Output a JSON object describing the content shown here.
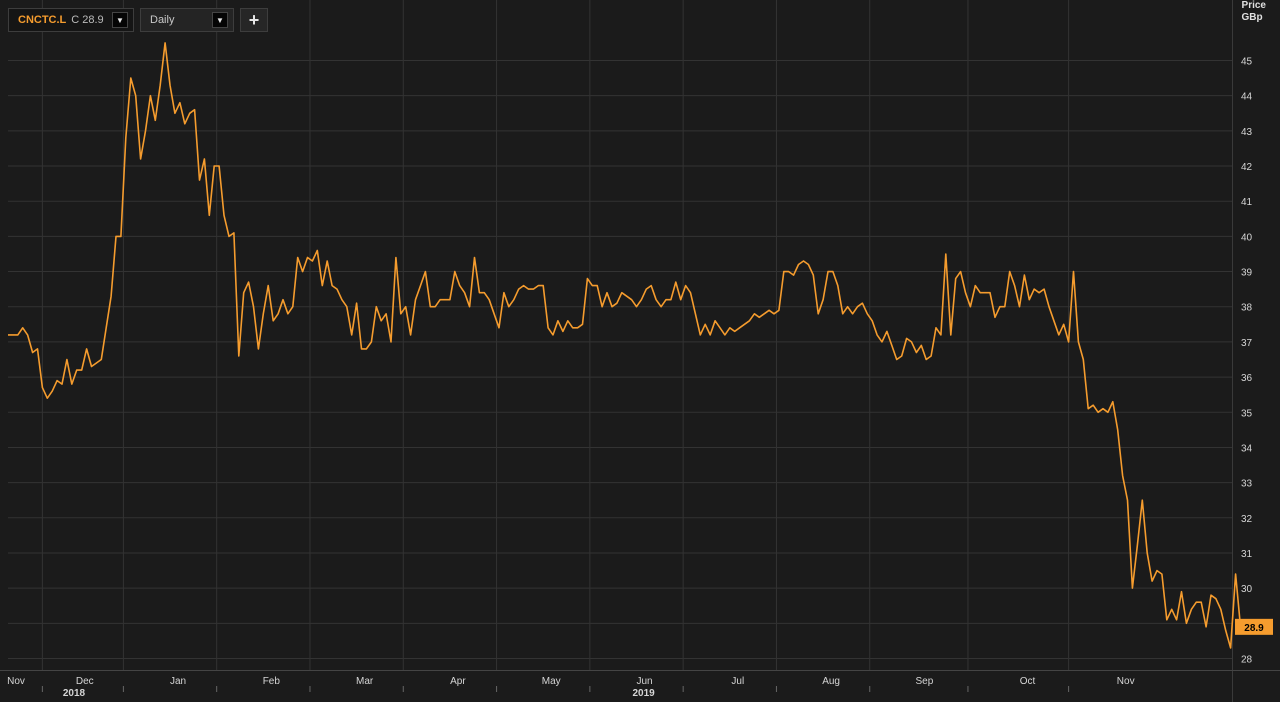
{
  "toolbar": {
    "symbol": "CNCTC.L",
    "close_label": "C",
    "close_value": "28.9",
    "interval": "Daily",
    "add_label": "+"
  },
  "axis": {
    "unit_line1": "Price",
    "unit_line2": "GBp"
  },
  "colors": {
    "line": "#f59c2e",
    "background": "#1b1b1b",
    "grid": "#333333"
  },
  "chart_data": {
    "type": "line",
    "title": "",
    "xlabel": "",
    "ylabel": "Price GBp",
    "ylim": [
      27.6,
      45.9
    ],
    "y_ticks": [
      28,
      29,
      30,
      31,
      32,
      33,
      34,
      35,
      36,
      37,
      38,
      39,
      40,
      41,
      42,
      43,
      44,
      45
    ],
    "x_range": [
      0,
      245
    ],
    "x_ticks": [
      {
        "x": 0,
        "label": "Nov"
      },
      {
        "x": 14,
        "label": "Dec"
      },
      {
        "x": 33,
        "label": "Jan"
      },
      {
        "x": 52,
        "label": "Feb"
      },
      {
        "x": 71,
        "label": "Mar"
      },
      {
        "x": 90,
        "label": "Apr"
      },
      {
        "x": 109,
        "label": "May"
      },
      {
        "x": 128,
        "label": "Jun"
      },
      {
        "x": 147,
        "label": "Jul"
      },
      {
        "x": 166,
        "label": "Aug"
      },
      {
        "x": 185,
        "label": "Sep"
      },
      {
        "x": 206,
        "label": "Oct"
      },
      {
        "x": 226,
        "label": "Nov"
      }
    ],
    "year_labels": [
      {
        "x": 11,
        "label": "2018"
      },
      {
        "x": 127,
        "label": "2019"
      }
    ],
    "last_value": 28.9,
    "series": [
      {
        "values": [
          37.2,
          37.2,
          37.2,
          37.4,
          37.2,
          36.7,
          36.8,
          35.7,
          35.4,
          35.6,
          35.9,
          35.8,
          36.5,
          35.8,
          36.2,
          36.2,
          36.8,
          36.3,
          36.4,
          36.5,
          37.4,
          38.3,
          40.0,
          40.0,
          42.8,
          44.5,
          44.0,
          42.2,
          43.0,
          44.0,
          43.3,
          44.3,
          45.5,
          44.3,
          43.5,
          43.8,
          43.2,
          43.5,
          43.6,
          41.6,
          42.2,
          40.6,
          42.0,
          42.0,
          40.6,
          40.0,
          40.1,
          36.6,
          38.4,
          38.7,
          38.0,
          36.8,
          37.8,
          38.6,
          37.6,
          37.8,
          38.2,
          37.8,
          38.0,
          39.4,
          39.0,
          39.4,
          39.3,
          39.6,
          38.6,
          39.3,
          38.6,
          38.5,
          38.2,
          38.0,
          37.2,
          38.1,
          36.8,
          36.8,
          37.0,
          38.0,
          37.6,
          37.8,
          37.0,
          39.4,
          37.8,
          38.0,
          37.2,
          38.2,
          38.6,
          39.0,
          38.0,
          38.0,
          38.2,
          38.2,
          38.2,
          39.0,
          38.6,
          38.4,
          38.0,
          39.4,
          38.4,
          38.4,
          38.2,
          37.8,
          37.4,
          38.4,
          38.0,
          38.2,
          38.5,
          38.6,
          38.5,
          38.5,
          38.6,
          38.6,
          37.4,
          37.2,
          37.6,
          37.3,
          37.6,
          37.4,
          37.4,
          37.5,
          38.8,
          38.6,
          38.6,
          38.0,
          38.4,
          38.0,
          38.1,
          38.4,
          38.3,
          38.2,
          38.0,
          38.2,
          38.5,
          38.6,
          38.2,
          38.0,
          38.2,
          38.2,
          38.7,
          38.2,
          38.6,
          38.4,
          37.8,
          37.2,
          37.5,
          37.2,
          37.6,
          37.4,
          37.2,
          37.4,
          37.3,
          37.4,
          37.5,
          37.6,
          37.8,
          37.7,
          37.8,
          37.9,
          37.8,
          37.9,
          39.0,
          39.0,
          38.9,
          39.2,
          39.3,
          39.2,
          38.9,
          37.8,
          38.2,
          39.0,
          39.0,
          38.6,
          37.8,
          38.0,
          37.8,
          38.0,
          38.1,
          37.8,
          37.6,
          37.2,
          37.0,
          37.3,
          36.9,
          36.5,
          36.6,
          37.1,
          37.0,
          36.7,
          36.9,
          36.5,
          36.6,
          37.4,
          37.2,
          39.5,
          37.2,
          38.8,
          39.0,
          38.4,
          38.0,
          38.6,
          38.4,
          38.4,
          38.4,
          37.7,
          38.0,
          38.0,
          39.0,
          38.6,
          38.0,
          38.9,
          38.2,
          38.5,
          38.4,
          38.5,
          38.0,
          37.6,
          37.2,
          37.5,
          37.0,
          39.0,
          37.0,
          36.5,
          35.1,
          35.2,
          35.0,
          35.1,
          35.0,
          35.3,
          34.5,
          33.2,
          32.5,
          30.0,
          31.2,
          32.5,
          31.0,
          30.2,
          30.5,
          30.4,
          29.1,
          29.4,
          29.1,
          29.9,
          29.0,
          29.4,
          29.6,
          29.6,
          28.9,
          29.8,
          29.7,
          29.4,
          28.8,
          28.3,
          30.4,
          28.9
        ]
      }
    ]
  }
}
